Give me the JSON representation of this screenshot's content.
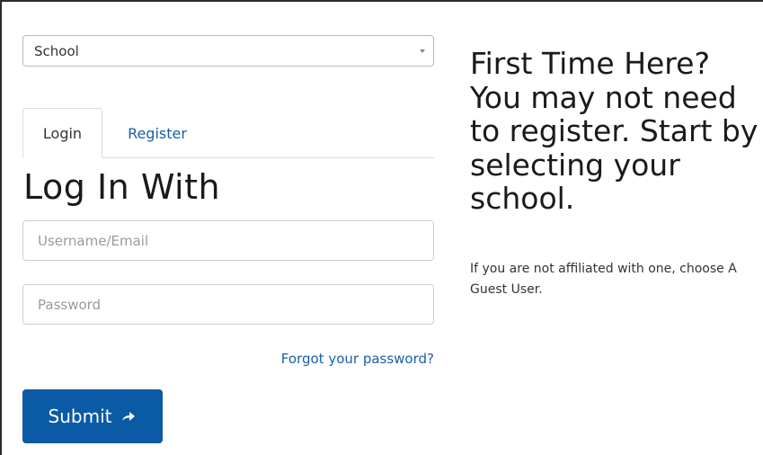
{
  "school_select": {
    "selected": "School"
  },
  "tabs": [
    {
      "label": "Login",
      "active": true
    },
    {
      "label": "Register",
      "active": false
    }
  ],
  "form": {
    "heading": "Log In With",
    "username_placeholder": "Username/Email",
    "password_placeholder": "Password",
    "forgot_link": "Forgot your password?",
    "submit_label": "Submit",
    "submit_icon": "arrow-right-icon"
  },
  "promo": {
    "title": "First Time Here? You may not need to register. Start by selecting your school.",
    "note": "If you are not affiliated with one, choose A Guest User."
  },
  "colors": {
    "primary": "#0b5aa6",
    "link": "#1a5ea8",
    "border": "#cfcfcf"
  }
}
